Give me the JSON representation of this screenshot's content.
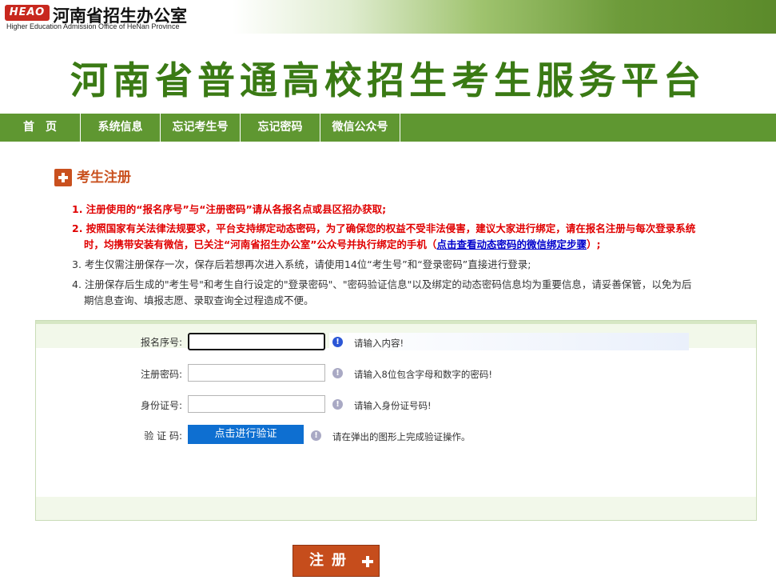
{
  "header": {
    "logo_text": "HEAO",
    "office_name_cn": "河南省招生办公室",
    "office_name_en": "Higher Education Admission Office of HeNan Province",
    "main_title": "河南省普通高校招生考生服务平台"
  },
  "nav": {
    "items": [
      {
        "label": "首　页"
      },
      {
        "label": "系统信息"
      },
      {
        "label": "忘记考生号"
      },
      {
        "label": "忘记密码"
      },
      {
        "label": "微信公众号"
      }
    ]
  },
  "section": {
    "title": "考生注册"
  },
  "notices": {
    "n1": "1. 注册使用的“报名序号”与“注册密码”请从各报名点或县区招办获取;",
    "n2_line1": "2. 按照国家有关法律法规要求，平台支持绑定动态密码，为了确保您的权益不受非法侵害，建议大家进行绑定，请在报名注册与每次登录系统",
    "n2_line2_prefix": "时，均携带安装有微信，已关注“河南省招生办公室”公众号并执行绑定的手机（",
    "n2_link": "点击查看动态密码的微信绑定步骤",
    "n2_line2_suffix": "）;",
    "n3": "3. 考生仅需注册保存一次，保存后若想再次进入系统，请使用14位“考生号”和“登录密码”直接进行登录;",
    "n4_line1": "4. 注册保存后生成的\"考生号\"和考生自行设定的\"登录密码\"、\"密码验证信息\"以及绑定的动态密码信息均为重要信息，请妥善保管，以免为后",
    "n4_line2": "期信息查询、填报志愿、录取查询全过程造成不便。"
  },
  "form": {
    "reg_no": {
      "label": "报名序号:",
      "value": "",
      "hint": "请输入内容!"
    },
    "reg_pwd": {
      "label": "注册密码:",
      "value": "",
      "hint": "请输入8位包含字母和数字的密码!"
    },
    "id_no": {
      "label": "身份证号:",
      "value": "",
      "hint": "请输入身份证号码!"
    },
    "captcha": {
      "label": "验 证 码:",
      "button": "点击进行验证",
      "hint": "请在弹出的图形上完成验证操作。"
    }
  },
  "submit": {
    "label": "注册"
  },
  "colors": {
    "nav_bg": "#5f9731",
    "title_green": "#3a7a14",
    "accent_orange": "#c9501e",
    "notice_red": "#e00000",
    "verify_blue": "#0e6fd1"
  }
}
